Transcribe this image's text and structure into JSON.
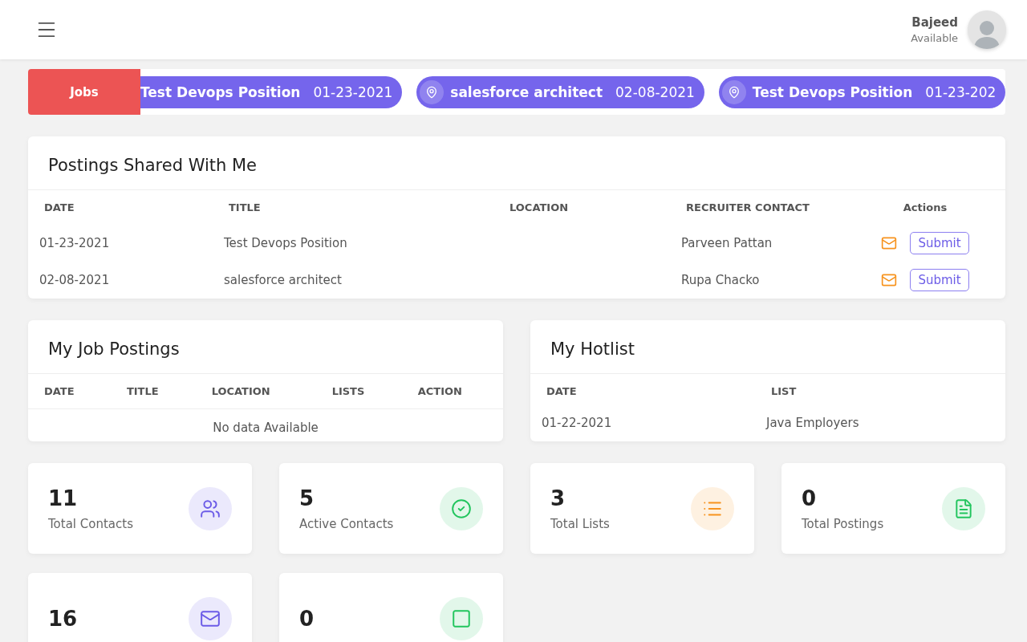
{
  "header": {
    "user_name": "Bajeed",
    "user_status": "Available"
  },
  "ticker": {
    "label": "Jobs",
    "items": [
      {
        "title": "Test Devops Position",
        "date": "01-23-2021",
        "pin": false
      },
      {
        "title": "salesforce architect",
        "date": "02-08-2021",
        "pin": true
      },
      {
        "title": "Test Devops Position",
        "date": "01-23-202",
        "pin": true
      }
    ]
  },
  "shared_postings": {
    "title": "Postings Shared With Me",
    "columns": [
      "DATE",
      "TITLE",
      "LOCATION",
      "RECRUITER CONTACT",
      "Actions"
    ],
    "rows": [
      {
        "date": "01-23-2021",
        "title": "Test Devops Position",
        "location": "",
        "recruiter": "Parveen Pattan",
        "action": "Submit"
      },
      {
        "date": "02-08-2021",
        "title": "salesforce architect",
        "location": "",
        "recruiter": "Rupa Chacko",
        "action": "Submit"
      }
    ]
  },
  "my_job_postings": {
    "title": "My Job Postings",
    "columns": [
      "DATE",
      "TITLE",
      "LOCATION",
      "LISTS",
      "ACTION"
    ],
    "empty_text": "No data Available"
  },
  "my_hotlist": {
    "title": "My Hotlist",
    "columns": [
      "DATE",
      "LIST"
    ],
    "rows": [
      {
        "date": "01-22-2021",
        "list": "Java Employers"
      }
    ]
  },
  "stats": [
    {
      "value": "11",
      "label": "Total Contacts",
      "kind": "users",
      "color": "#6c5ce7"
    },
    {
      "value": "5",
      "label": "Active Contacts",
      "kind": "check",
      "color": "#22c55e"
    },
    {
      "value": "3",
      "label": "Total Lists",
      "kind": "list",
      "color": "#f7931e"
    },
    {
      "value": "0",
      "label": "Total Postings",
      "kind": "file",
      "color": "#22c55e"
    },
    {
      "value": "16",
      "kind": "mail",
      "color": "#6c5ce7"
    },
    {
      "value": "0",
      "kind": "square",
      "color": "#22c55e"
    }
  ]
}
